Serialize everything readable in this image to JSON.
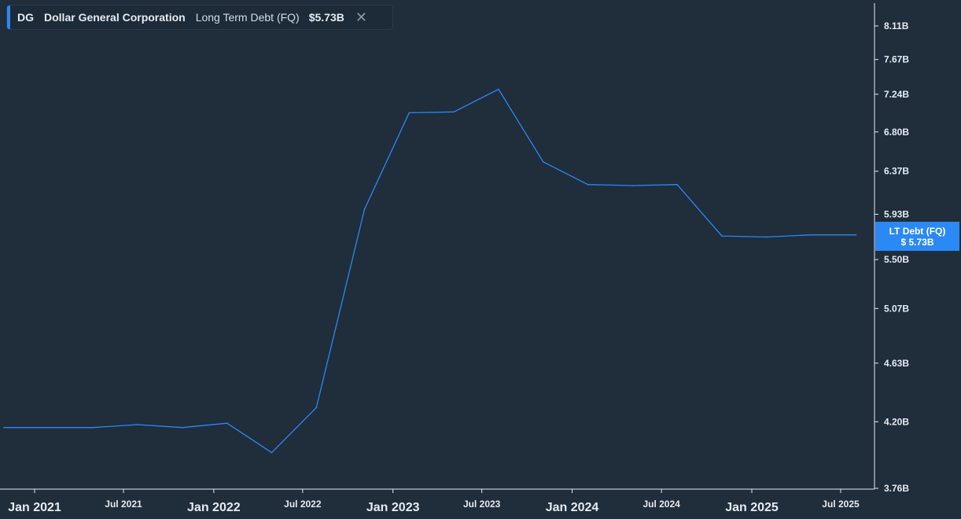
{
  "legend": {
    "ticker": "DG",
    "company": "Dollar General Corporation",
    "metric": "Long Term Debt (FQ)",
    "value": "$5.73B",
    "close_glyph": "✕"
  },
  "price_label": {
    "line1": "LT Debt (FQ)",
    "line2": "$ 5.73B"
  },
  "colors": {
    "background": "#202d3b",
    "line": "#2a89f5",
    "axis": "#e6ebf0",
    "accent": "#2a89f5"
  },
  "chart_data": {
    "type": "line",
    "title": "",
    "xlabel": "",
    "ylabel": "",
    "series": [
      {
        "name": "LT Debt (FQ)",
        "x": [
          "2020-10-30",
          "2021-01-29",
          "2021-04-30",
          "2021-07-30",
          "2021-10-29",
          "2022-01-28",
          "2022-04-29",
          "2022-07-29",
          "2022-11-04",
          "2023-02-03",
          "2023-05-05",
          "2023-08-04",
          "2023-11-03",
          "2024-02-02",
          "2024-05-03",
          "2024-08-02",
          "2024-11-01",
          "2025-01-31",
          "2025-05-02",
          "2025-08-01"
        ],
        "y": [
          4.16,
          4.16,
          4.16,
          4.18,
          4.16,
          4.19,
          3.99,
          4.3,
          5.98,
          7.02,
          7.03,
          7.3,
          6.47,
          6.23,
          6.22,
          6.23,
          5.72,
          5.71,
          5.73,
          5.73
        ]
      }
    ],
    "y_ticks": [
      "3.76B",
      "4.20B",
      "4.63B",
      "5.07B",
      "5.50B",
      "5.93B",
      "6.37B",
      "6.80B",
      "7.24B",
      "7.67B",
      "8.11B"
    ],
    "y_tick_values": [
      3.76,
      4.2,
      4.63,
      5.07,
      5.5,
      5.93,
      6.37,
      6.8,
      7.24,
      7.67,
      8.11
    ],
    "y_scale": "log",
    "x_ticks": [
      {
        "label": "Jan 2021",
        "date": "2021-01-01",
        "major": true
      },
      {
        "label": "Jul 2021",
        "date": "2021-07-01",
        "major": false
      },
      {
        "label": "Jan 2022",
        "date": "2022-01-01",
        "major": true
      },
      {
        "label": "Jul 2022",
        "date": "2022-07-01",
        "major": false
      },
      {
        "label": "Jan 2023",
        "date": "2023-01-01",
        "major": true
      },
      {
        "label": "Jul 2023",
        "date": "2023-07-01",
        "major": false
      },
      {
        "label": "Jan 2024",
        "date": "2024-01-01",
        "major": true
      },
      {
        "label": "Jul 2024",
        "date": "2024-07-01",
        "major": false
      },
      {
        "label": "Jan 2025",
        "date": "2025-01-01",
        "major": true
      },
      {
        "label": "Jul 2025",
        "date": "2025-07-01",
        "major": false
      }
    ],
    "grid": false,
    "legend_position": "top-left"
  }
}
